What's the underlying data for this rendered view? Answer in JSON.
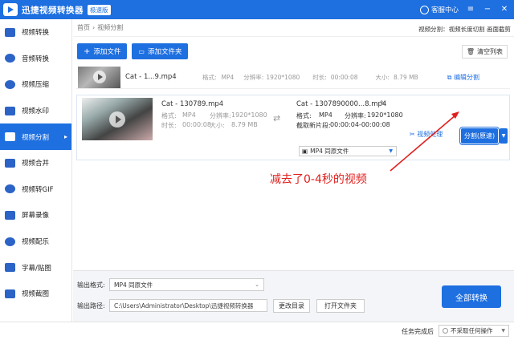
{
  "titlebar": {
    "app_title": "迅捷视频转换器",
    "badge": "极速版",
    "vip_label": "客服中心",
    "menu_icon": "hamburger",
    "minimize_icon": "minus",
    "close_icon": "x"
  },
  "sidebar": {
    "items": [
      {
        "label": "视频转换",
        "icon": "video-convert-icon"
      },
      {
        "label": "音频转换",
        "icon": "audio-convert-icon"
      },
      {
        "label": "视频压缩",
        "icon": "compress-icon"
      },
      {
        "label": "视频水印",
        "icon": "watermark-icon"
      },
      {
        "label": "视频分割",
        "icon": "split-icon",
        "active": true
      },
      {
        "label": "视频合并",
        "icon": "merge-icon"
      },
      {
        "label": "视频转GIF",
        "icon": "gif-icon"
      },
      {
        "label": "屏幕录像",
        "icon": "record-icon"
      },
      {
        "label": "视频配乐",
        "icon": "music-icon"
      },
      {
        "label": "字幕/贴图",
        "icon": "subtitle-icon"
      },
      {
        "label": "视频截图",
        "icon": "screenshot-icon"
      }
    ]
  },
  "breadcrumb": {
    "home": "首页",
    "sep": "›",
    "current": "视频分割"
  },
  "header_note": "视频分割：视频长度切割 画面截剪",
  "toolbar": {
    "add_file": "添加文件",
    "add_folder": "添加文件夹",
    "clear_list": "清空列表"
  },
  "source_row": {
    "filename": "Cat - 1...9.mp4",
    "format_label": "格式:",
    "format_value": "MP4",
    "resolution_label": "分辨率:",
    "resolution_value": "1920*1080",
    "duration_label": "时长:",
    "duration_value": "00:00:08",
    "size_label": "大小:",
    "size_value": "8.79 MB",
    "edit_split": "编辑分割"
  },
  "segment_row": {
    "in_filename": "Cat - 130789.mp4",
    "in_format_label": "格式:",
    "in_format": "MP4",
    "in_res_label": "分辨率:",
    "in_res": "1920*1080",
    "in_duration_label": "时长:",
    "in_duration": "00:00:08",
    "in_size_label": "大小:",
    "in_size": "8.79 MB",
    "out_filename": "Cat - 1307890000...8.mp4",
    "out_format_label": "格式:",
    "out_format": "MP4",
    "out_res_label": "分辨率:",
    "out_res": "1920*1080",
    "clip_label": "截取新片段:",
    "clip_range": "00:00:04-00:00:08",
    "out_select": "MP4 同原文件",
    "video_process": "视频处理",
    "split_button": "分割(原速)"
  },
  "annotation": "减去了0-4秒的视频",
  "bottom": {
    "output_format_label": "输出格式:",
    "output_format_value": "MP4 同原文件",
    "output_path_label": "输出路径:",
    "output_path_value": "C:\\Users\\Administrator\\Desktop\\迅捷视频转换器",
    "change_dir": "更改目录",
    "open_folder": "打开文件夹",
    "convert_all": "全部转换"
  },
  "status": {
    "done_label": "任务完成后",
    "done_option": "不采取任何操作"
  },
  "colors": {
    "primary": "#1E6FE0",
    "annotation": "#E0201D"
  }
}
